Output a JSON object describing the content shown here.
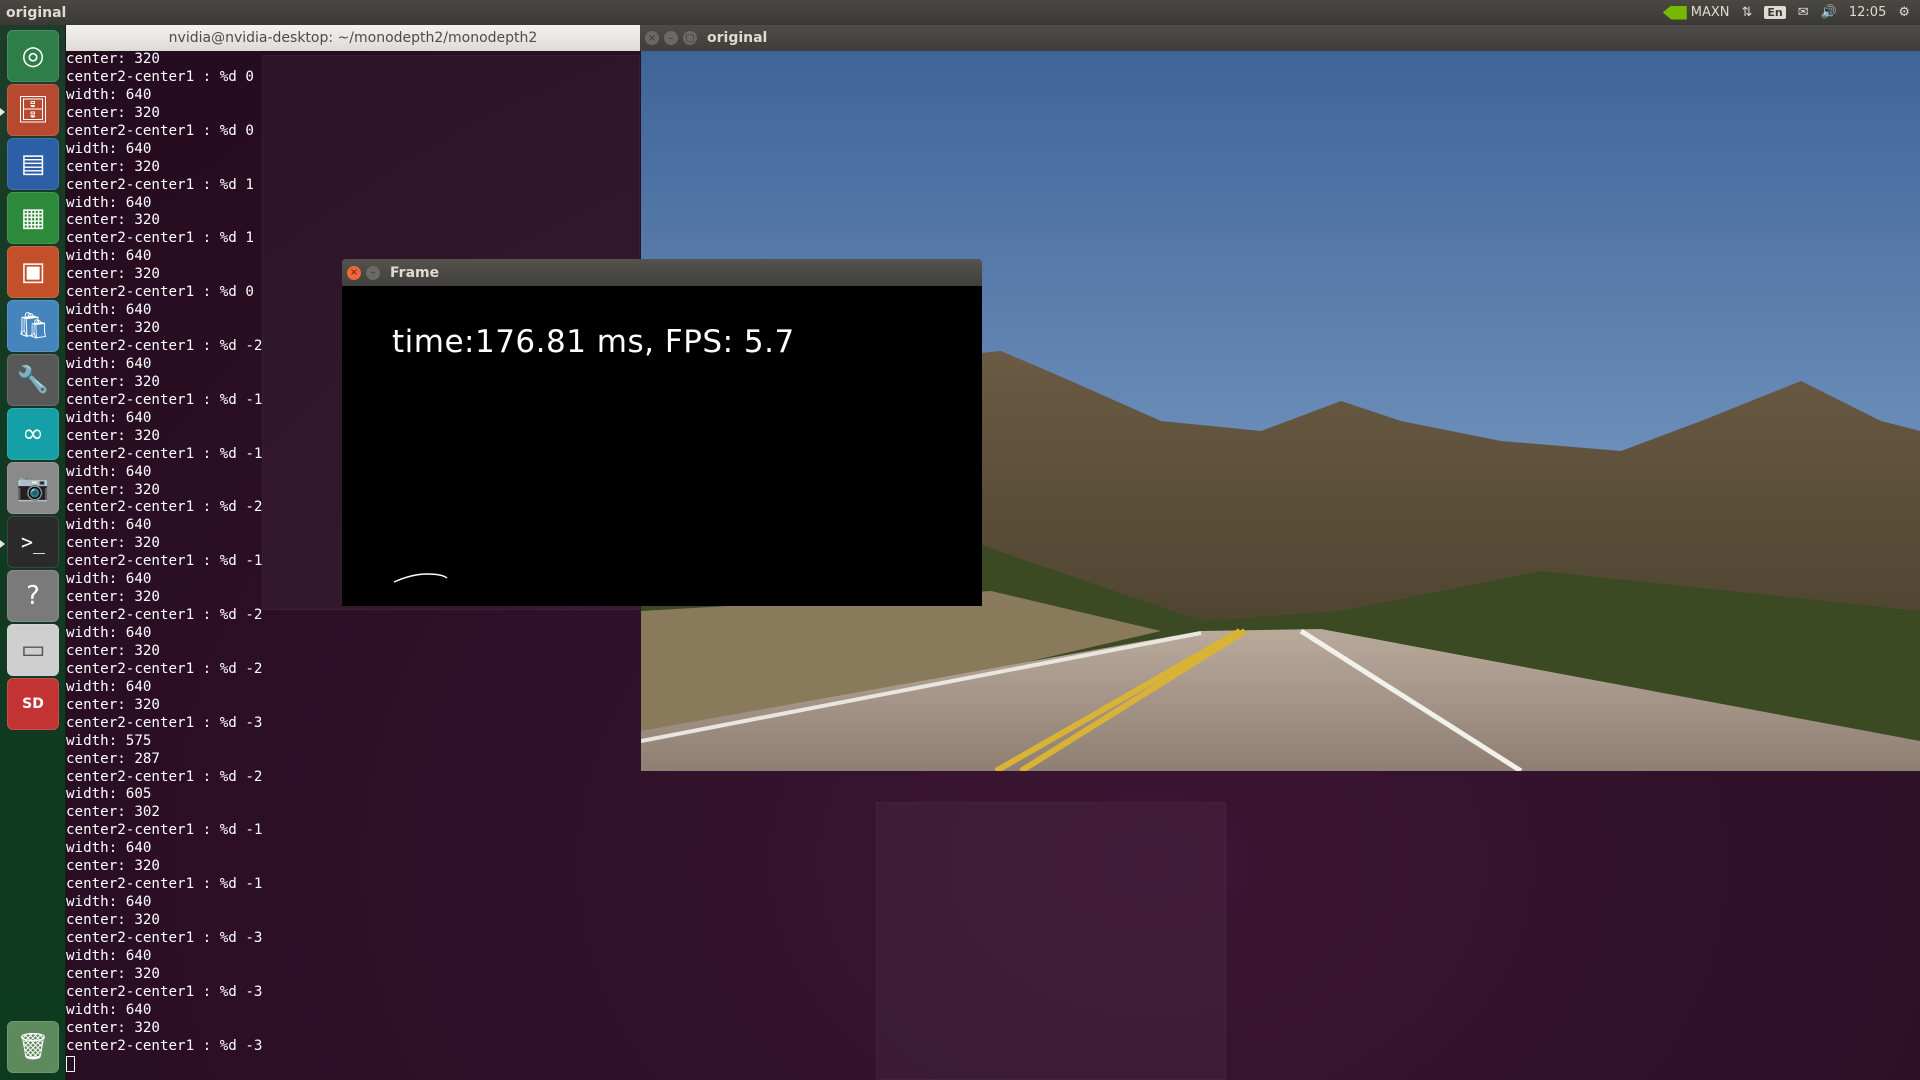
{
  "top_panel": {
    "app_title": "original",
    "indicators": {
      "power_mode": "MAXN",
      "keyboard_layout": "En",
      "clock": "12:05"
    }
  },
  "launcher": {
    "items": [
      {
        "name": "dash-home",
        "icon": "ubuntu-logo-icon",
        "color": "#3a8a55"
      },
      {
        "name": "files",
        "icon": "file-cabinet-icon",
        "color": "#c6482c"
      },
      {
        "name": "libreoffice-writer",
        "icon": "writer-doc-icon",
        "color": "#2d62a9"
      },
      {
        "name": "libreoffice-calc",
        "icon": "calc-sheet-icon",
        "color": "#2f8d3a"
      },
      {
        "name": "libreoffice-impress",
        "icon": "impress-slide-icon",
        "color": "#c9532b"
      },
      {
        "name": "software-center",
        "icon": "shopping-bag-icon",
        "color": "#4a90c8"
      },
      {
        "name": "system-settings",
        "icon": "settings-tools-icon",
        "color": "#5f5f5f"
      },
      {
        "name": "arduino",
        "icon": "arduino-infinity-icon",
        "color": "#15a1a7"
      },
      {
        "name": "screenshot",
        "icon": "camera-icon",
        "color": "#8d8d8d"
      },
      {
        "name": "terminal",
        "icon": "terminal-prompt-icon",
        "color": "#2b2b2b"
      },
      {
        "name": "help",
        "icon": "question-mark-icon",
        "color": "#7b7b7b"
      },
      {
        "name": "drive",
        "icon": "removable-drive-icon",
        "color": "#cfcfcf"
      },
      {
        "name": "sd-card",
        "icon": "sd-card-icon",
        "color": "#c93737",
        "label": "SD"
      },
      {
        "name": "trash",
        "icon": "trash-icon",
        "color": "#6b8e6b"
      }
    ]
  },
  "terminal": {
    "title": "nvidia@nvidia-desktop: ~/monodepth2/monodepth2",
    "lines": [
      "center: 320",
      "center2-center1 : %d 0",
      "width: 640",
      "center: 320",
      "center2-center1 : %d 0",
      "width: 640",
      "center: 320",
      "center2-center1 : %d 1",
      "width: 640",
      "center: 320",
      "center2-center1 : %d 1",
      "width: 640",
      "center: 320",
      "center2-center1 : %d 0",
      "width: 640",
      "center: 320",
      "center2-center1 : %d -2",
      "width: 640",
      "center: 320",
      "center2-center1 : %d -1",
      "width: 640",
      "center: 320",
      "center2-center1 : %d -1",
      "width: 640",
      "center: 320",
      "center2-center1 : %d -2",
      "width: 640",
      "center: 320",
      "center2-center1 : %d -1",
      "width: 640",
      "center: 320",
      "center2-center1 : %d -2",
      "width: 640",
      "center: 320",
      "center2-center1 : %d -2",
      "width: 640",
      "center: 320",
      "center2-center1 : %d -3",
      "width: 575",
      "center: 287",
      "center2-center1 : %d -2",
      "width: 605",
      "center: 302",
      "center2-center1 : %d -1",
      "width: 640",
      "center: 320",
      "center2-center1 : %d -1",
      "width: 640",
      "center: 320",
      "center2-center1 : %d -3",
      "width: 640",
      "center: 320",
      "center2-center1 : %d -3",
      "width: 640",
      "center: 320",
      "center2-center1 : %d -3"
    ]
  },
  "original_window": {
    "title": "original"
  },
  "frame_window": {
    "title": "Frame",
    "overlay_text": "time:176.81  ms, FPS: 5.7"
  }
}
